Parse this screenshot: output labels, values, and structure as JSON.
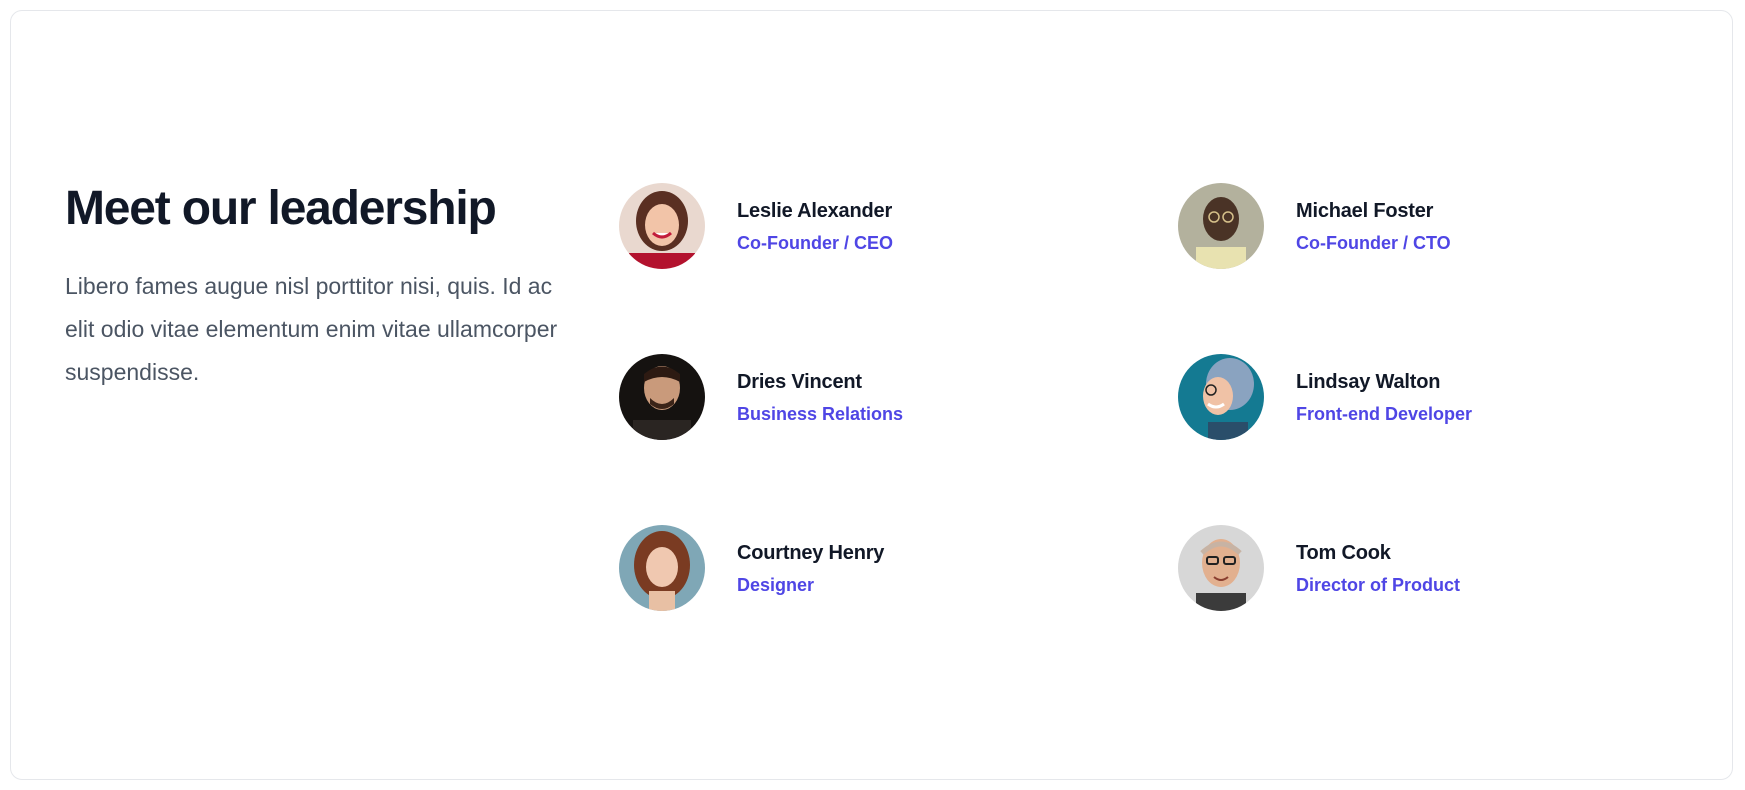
{
  "section": {
    "title": "Meet our leadership",
    "description": "Libero fames augue nisl porttitor nisi, quis. Id ac elit odio vitae elementum enim vitae ullamcorper suspendisse."
  },
  "people": [
    {
      "name": "Leslie Alexander",
      "role": "Co-Founder / CEO",
      "avatar": "person-photo-icon"
    },
    {
      "name": "Michael Foster",
      "role": "Co-Founder / CTO",
      "avatar": "person-photo-icon"
    },
    {
      "name": "Dries Vincent",
      "role": "Business Relations",
      "avatar": "person-photo-icon"
    },
    {
      "name": "Lindsay Walton",
      "role": "Front-end Developer",
      "avatar": "person-photo-icon"
    },
    {
      "name": "Courtney Henry",
      "role": "Designer",
      "avatar": "person-photo-icon"
    },
    {
      "name": "Tom Cook",
      "role": "Director of Product",
      "avatar": "person-photo-icon"
    }
  ],
  "colors": {
    "accent": "#4f46e5",
    "heading": "#111827",
    "body": "#4b5563",
    "border": "#e5e7eb"
  }
}
